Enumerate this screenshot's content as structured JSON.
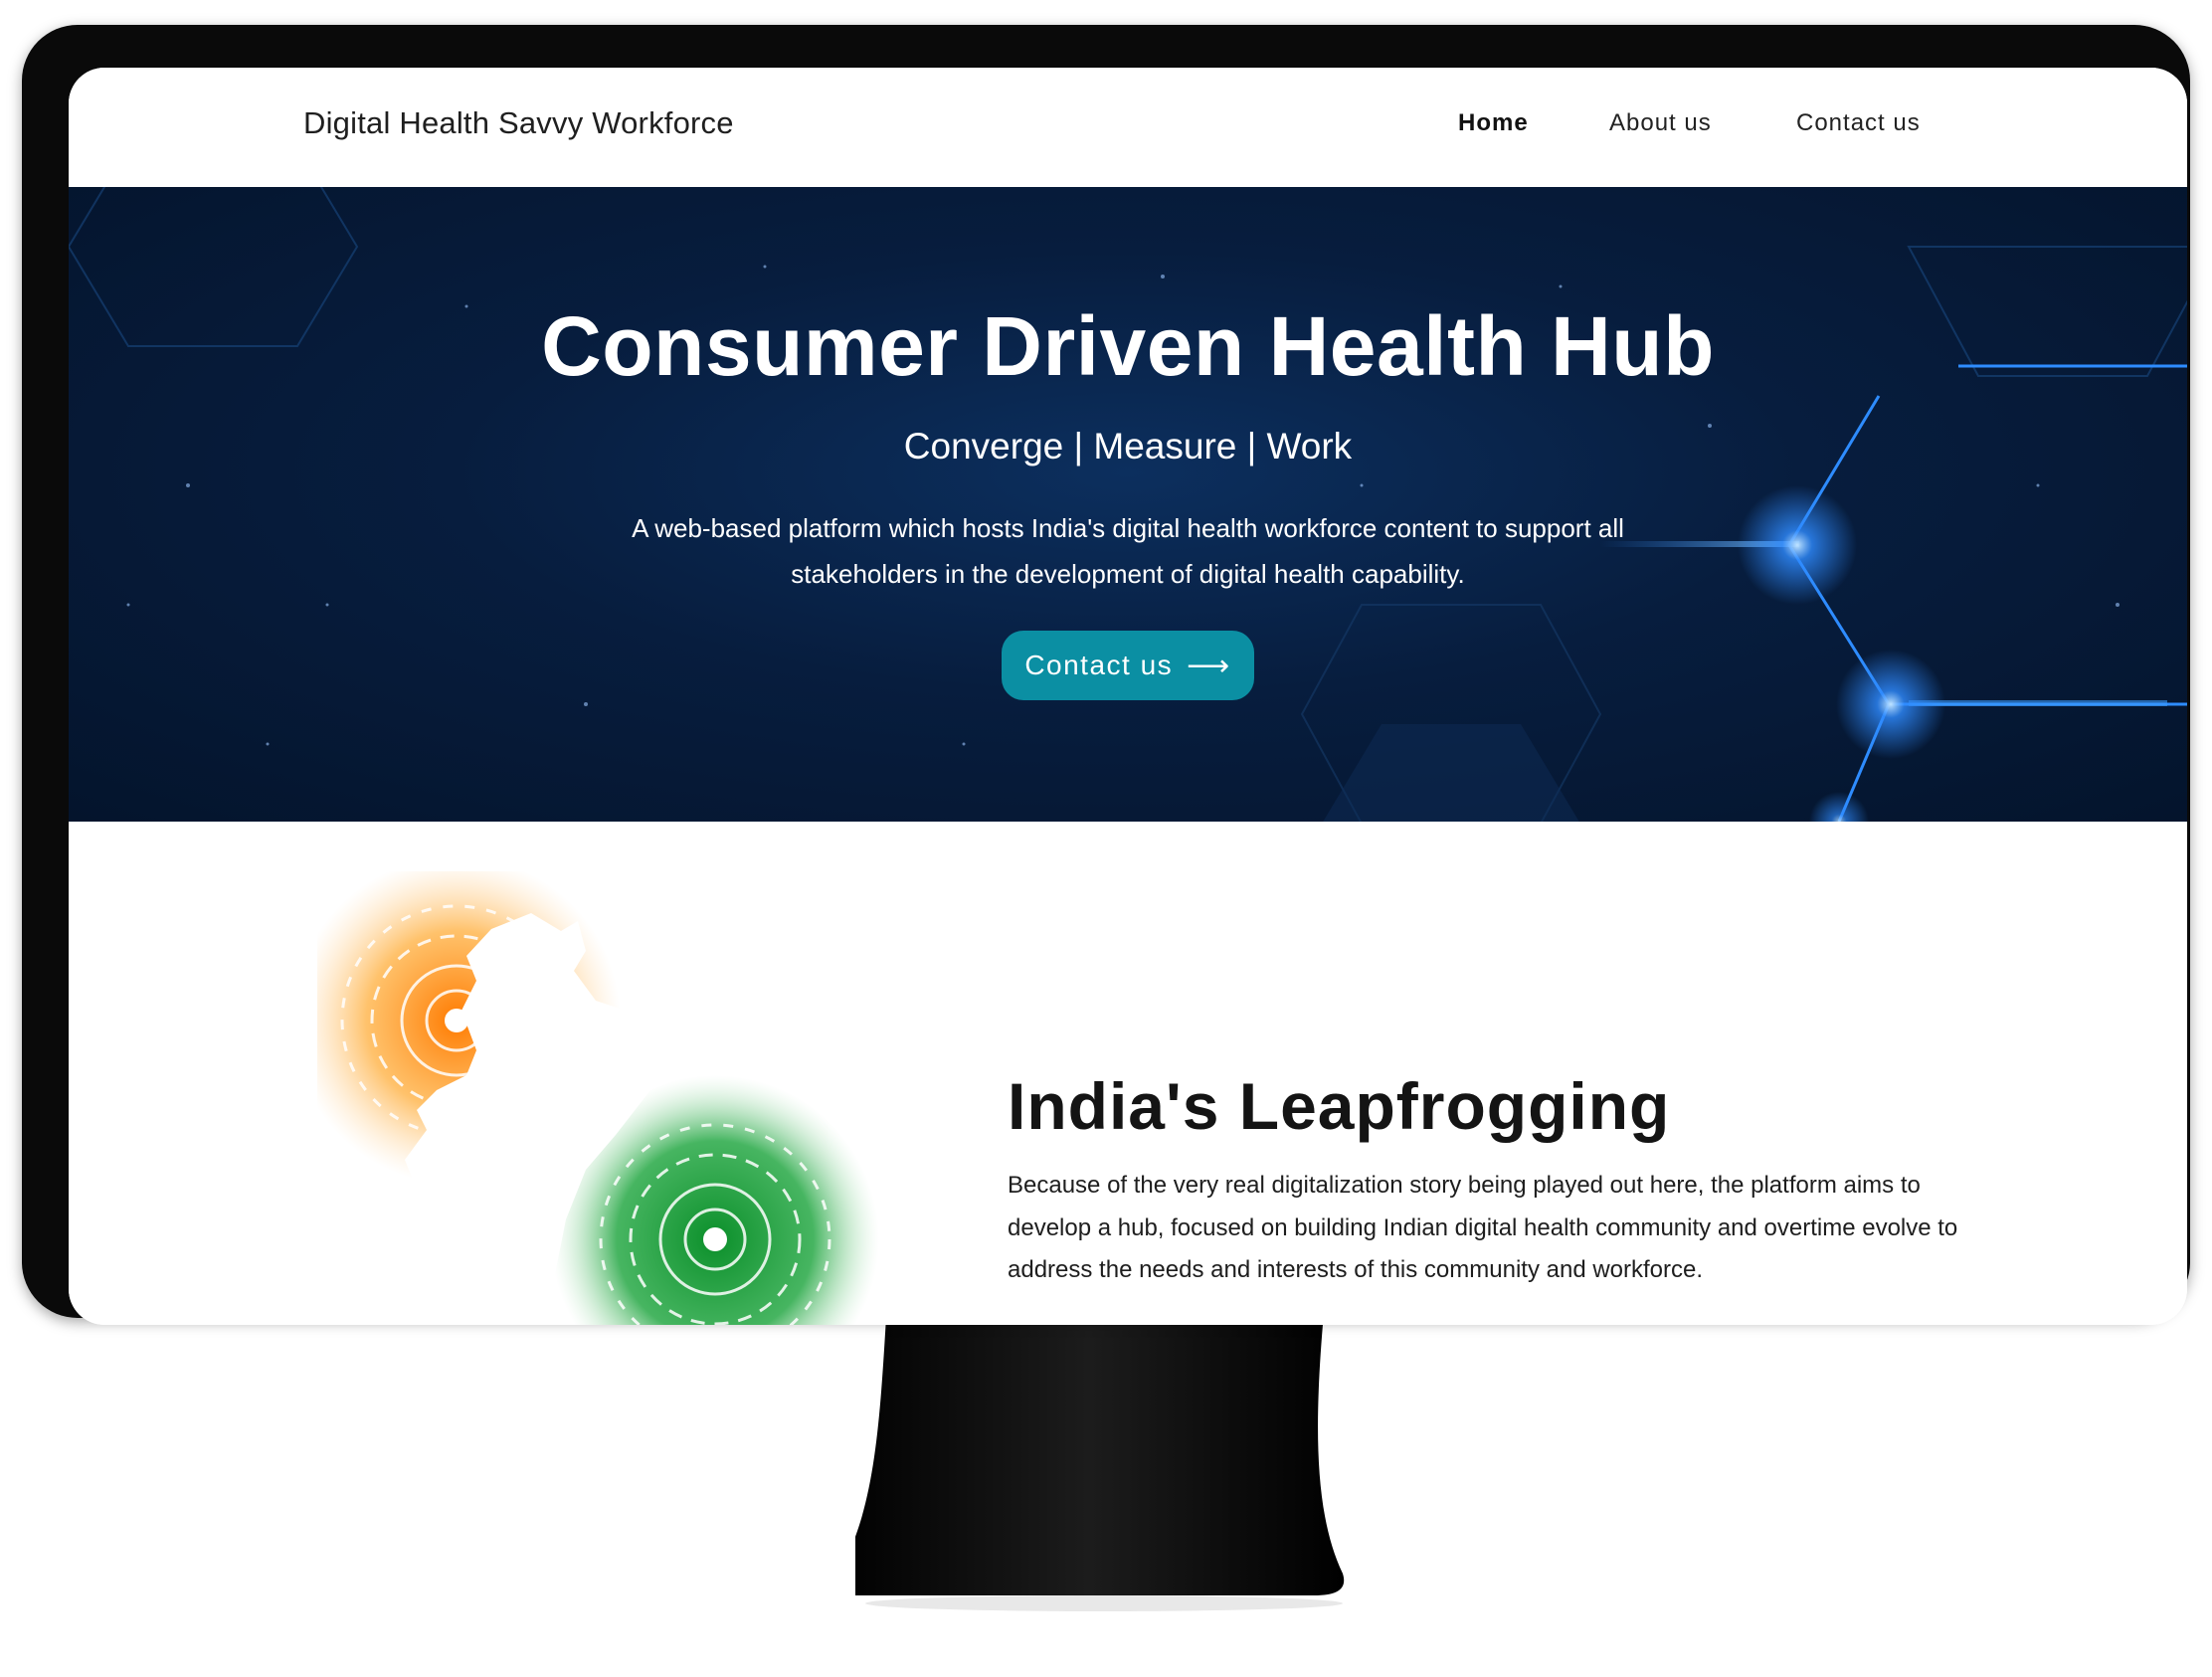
{
  "nav": {
    "brand": "Digital Health Savvy Workforce",
    "links": [
      {
        "label": "Home",
        "active": true
      },
      {
        "label": "About us",
        "active": false
      },
      {
        "label": "Contact us",
        "active": false
      }
    ]
  },
  "hero": {
    "title": "Consumer Driven Health Hub",
    "tagline": "Converge | Measure | Work",
    "description": "A web-based platform which hosts India's digital health workforce content to support all stakeholders in the development of digital health capability.",
    "cta_label": "Contact us",
    "cta_icon": "arrow-right-icon",
    "cta_color": "#0b8fa3"
  },
  "leap": {
    "title": "India's Leapfrogging",
    "body": "Because of the very real digitalization story being played out here, the platform aims to develop a hub, focused on building Indian digital health community and overtime evolve to address the needs and interests of this community and workforce."
  },
  "colors": {
    "hero_bg": "#071d3e",
    "accent_glow": "#2f8bff",
    "saffron": "#f59a1b",
    "green": "#1fa03a"
  }
}
